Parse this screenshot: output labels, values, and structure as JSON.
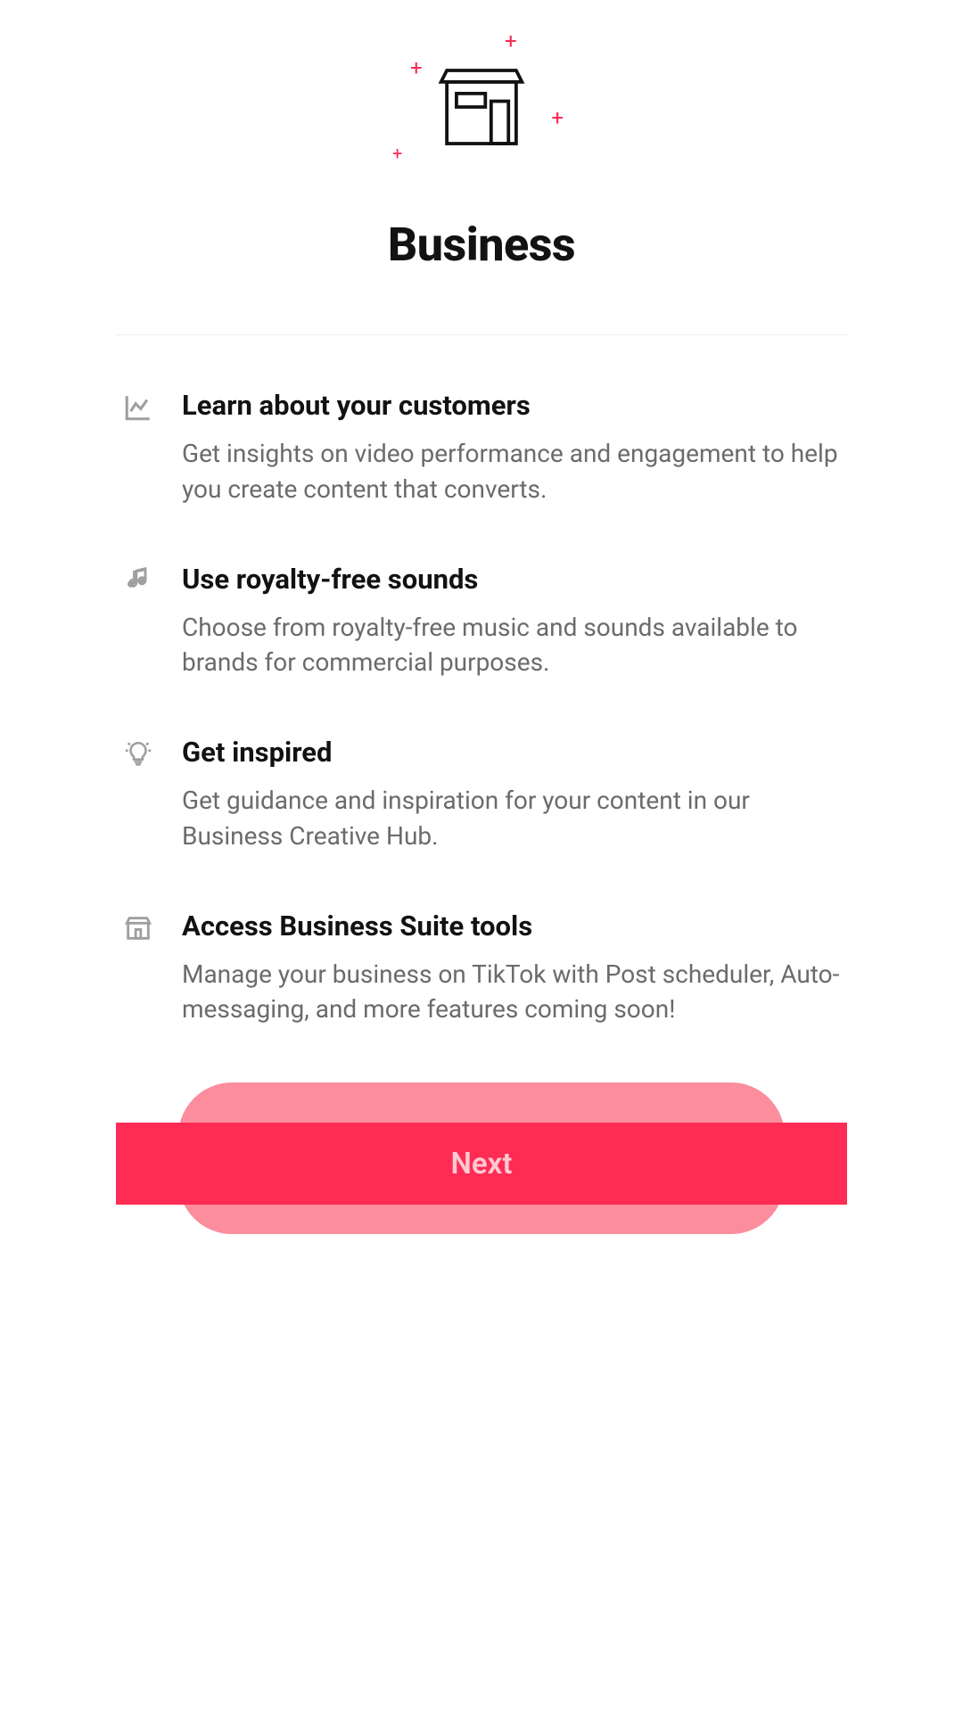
{
  "page": {
    "title": "Business"
  },
  "features": [
    {
      "icon": "chart",
      "title": "Learn about your customers",
      "desc": "Get insights on video performance and engagement to help you create content that converts."
    },
    {
      "icon": "music",
      "title": "Use royalty-free sounds",
      "desc": "Choose from royalty-free music and sounds available to brands for commercial purposes."
    },
    {
      "icon": "lightbulb",
      "title": "Get inspired",
      "desc": "Get guidance and inspiration for your content in our Business Creative Hub."
    },
    {
      "icon": "store",
      "title": "Access Business Suite tools",
      "desc": "Manage your business on TikTok with Post scheduler, Auto-messaging, and more features coming soon!"
    }
  ],
  "actions": {
    "next_label": "Next"
  },
  "colors": {
    "accent": "#FE2C55",
    "accent_light": "#fb8d9d",
    "text": "#121212",
    "text_muted": "#6b6b6b"
  }
}
